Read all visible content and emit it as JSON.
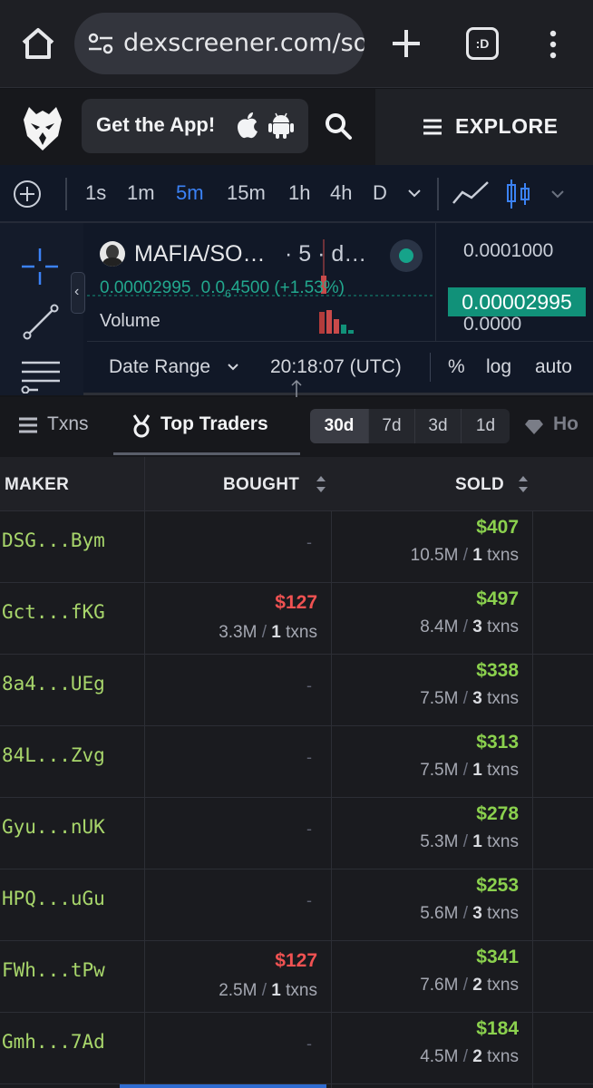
{
  "browser": {
    "url": "dexscreener.com/sol",
    "tabs_label": ":D"
  },
  "header": {
    "get_app_label": "Get the App!",
    "explore_label": "EXPLORE"
  },
  "toolbar": {
    "timeframes": [
      "1s",
      "1m",
      "5m",
      "15m",
      "1h",
      "4h",
      "D"
    ],
    "active_timeframe": "5m"
  },
  "chart": {
    "pair": "MAFIA/SO…",
    "interval_info": "· 5 · d…",
    "price_open": "0.00002995",
    "price_change_prefix": "0.0",
    "price_change_sub": "6",
    "price_change_rest": "4500",
    "price_change_pct": "(+1.53%)",
    "volume_label": "Volume",
    "axis_top": "0.0001000",
    "axis_price": "0.00002995",
    "axis_bottom": "0.0000",
    "date_range_label": "Date Range",
    "time_utc": "20:18:07 (UTC)",
    "pct_label": "%",
    "log_label": "log",
    "auto_label": "auto"
  },
  "tabs": {
    "txns_label": "Txns",
    "top_traders_label": "Top Traders",
    "holders_label": "Ho",
    "periods": [
      "30d",
      "7d",
      "3d",
      "1d"
    ],
    "active_period": "30d"
  },
  "table": {
    "headers": {
      "maker": "MAKER",
      "bought": "BOUGHT",
      "sold": "SOLD"
    },
    "empty_placeholder": "-",
    "rows": [
      {
        "maker": "DSG...Bym",
        "bought_usd": "",
        "bought_amount": "",
        "bought_txns": "",
        "sold_usd": "$407",
        "sold_amount": "10.5M",
        "sold_txns": "1"
      },
      {
        "maker": "Gct...fKG",
        "bought_usd": "$127",
        "bought_amount": "3.3M",
        "bought_txns": "1",
        "sold_usd": "$497",
        "sold_amount": "8.4M",
        "sold_txns": "3"
      },
      {
        "maker": "8a4...UEg",
        "bought_usd": "",
        "bought_amount": "",
        "bought_txns": "",
        "sold_usd": "$338",
        "sold_amount": "7.5M",
        "sold_txns": "3"
      },
      {
        "maker": "84L...Zvg",
        "bought_usd": "",
        "bought_amount": "",
        "bought_txns": "",
        "sold_usd": "$313",
        "sold_amount": "7.5M",
        "sold_txns": "1"
      },
      {
        "maker": "Gyu...nUK",
        "bought_usd": "",
        "bought_amount": "",
        "bought_txns": "",
        "sold_usd": "$278",
        "sold_amount": "5.3M",
        "sold_txns": "1"
      },
      {
        "maker": "HPQ...uGu",
        "bought_usd": "",
        "bought_amount": "",
        "bought_txns": "",
        "sold_usd": "$253",
        "sold_amount": "5.6M",
        "sold_txns": "3"
      },
      {
        "maker": "FWh...tPw",
        "bought_usd": "$127",
        "bought_amount": "2.5M",
        "bought_txns": "1",
        "sold_usd": "$341",
        "sold_amount": "7.6M",
        "sold_txns": "2"
      },
      {
        "maker": "Gmh...7Ad",
        "bought_usd": "",
        "bought_amount": "",
        "bought_txns": "",
        "sold_usd": "$184",
        "sold_amount": "4.5M",
        "sold_txns": "2"
      }
    ],
    "txns_suffix": "txns"
  },
  "colors": {
    "accent_blue": "#3b82f6",
    "buy_red": "#f05252",
    "sell_green": "#8bd14e",
    "price_teal": "#119179"
  }
}
